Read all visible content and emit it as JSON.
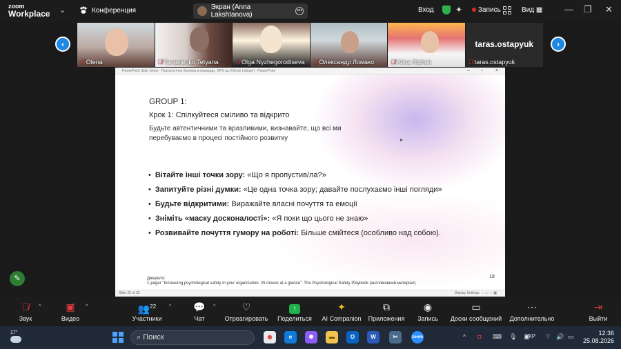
{
  "app": {
    "logo_line1": "zoom",
    "logo_line2": "Workplace"
  },
  "top": {
    "meeting_label": "Конференция",
    "screen_pill": "Экран (Anna Lakshtanova)",
    "signin": "Вход",
    "record": "Запись",
    "view": "Вид"
  },
  "participants": [
    {
      "name": "Olena",
      "muted": true
    },
    {
      "name": "Tanasienko Tetyana",
      "muted": true
    },
    {
      "name": "Olga Nyzhegorodtseva",
      "muted": true
    },
    {
      "name": "Олександр Ломако",
      "muted": true
    },
    {
      "name": "Alina Rizhok",
      "muted": true
    },
    {
      "name": "taras.ostapyuk",
      "muted": true,
      "video_off": true
    }
  ],
  "share_window": {
    "title": "PowerPoint Slide Show  -  Психологічна безпека в командах_NPD ua (Olenin Industri) - PowerPoint",
    "status_left": "Slide 25 of 32",
    "status_right": "Display Settings"
  },
  "slide": {
    "group": "GROUP 1:",
    "step": "Крок 1: Спілкуйтеся сміливо та відкрито",
    "description": "Будьте автентичними та вразливими, визнавайте, що всі ми перебуваємо в процесі постійного розвитку",
    "bullets": [
      {
        "bold": "Вітайте інші точки зору:",
        "text": " «Що я пропустив/ла?»"
      },
      {
        "bold": "Запитуйте різні думки:",
        "text": " «Це одна точка зору; давайте послухаємо інші погляди»"
      },
      {
        "bold": "Будьте відкритими:",
        "text": " Виражайте власні почуття та емоції"
      },
      {
        "bold": "Зніміть «маску досконалості»:",
        "text": " «Я поки що цього не знаю»"
      },
      {
        "bold": "Розвивайте почуття гумору на роботі:",
        "text": " Більше смійтеся (особливо над собою)."
      }
    ],
    "source_label": "Джерело:",
    "source_text": "1-pager \"Increasing psychological safety in your organization: 25 moves at a glance\". The Psychological Safety Playbook (англомовний матеріал)",
    "page_number": "19"
  },
  "toolbar": {
    "audio": "Звук",
    "video": "Видео",
    "participants": "Участники",
    "participants_count": "22",
    "chat": "Чат",
    "react": "Отреагировать",
    "share": "Поделиться",
    "ai": "AI Companion",
    "apps": "Приложения",
    "record": "Запись",
    "whiteboards": "Доски сообщений",
    "more": "Дополнительно",
    "leave": "Выйти"
  },
  "taskbar": {
    "weather_temp": "17°",
    "search_placeholder": "Поиск",
    "language": "УКР",
    "time": "12:36",
    "date": "25.08.2026"
  },
  "colors": {
    "accent": "#1e88e5",
    "share_green": "#20b24a",
    "muted_red": "#e63c3c"
  }
}
